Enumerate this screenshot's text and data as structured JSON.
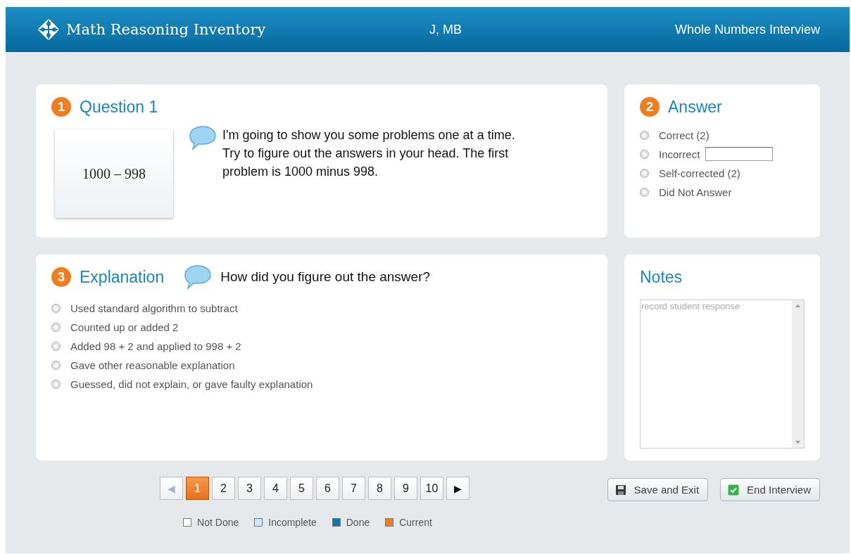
{
  "header": {
    "logo_text": "Math Reasoning Inventory",
    "student": "J, MB",
    "interview": "Whole Numbers Interview"
  },
  "question": {
    "number": "1",
    "title": "Question 1",
    "card_text": "1000 – 998",
    "prompt": "I'm going to show you some problems one at a time. Try to figure out the answers in your head. The first problem is 1000 minus 998."
  },
  "answer": {
    "number": "2",
    "title": "Answer",
    "options": [
      {
        "label": "Correct (2)",
        "selected": false,
        "kind": "radio"
      },
      {
        "label": "Incorrect",
        "selected": false,
        "kind": "with_field"
      },
      {
        "label": "Self-corrected (2)",
        "selected": false,
        "kind": "radio"
      },
      {
        "label": "Did Not Answer",
        "selected": false,
        "kind": "radio"
      }
    ]
  },
  "explanation": {
    "number": "3",
    "title": "Explanation",
    "prompt": "How did you figure out the answer?",
    "options": [
      {
        "label": "Used standard algorithm to subtract",
        "selected": false
      },
      {
        "label": "Counted up or added 2",
        "selected": false
      },
      {
        "label": "Added 98 + 2 and applied to 998 + 2",
        "selected": false
      },
      {
        "label": "Gave other reasonable explanation",
        "selected": false
      },
      {
        "label": "Guessed, did not explain, or gave faulty explanation",
        "selected": false
      }
    ]
  },
  "notes": {
    "title": "Notes",
    "placeholder": "record student response"
  },
  "pagination": {
    "prev": {
      "label": "◀",
      "disabled": true
    },
    "next": {
      "label": "▶",
      "disabled": false
    },
    "pages": [
      {
        "label": "1",
        "selected": true
      },
      {
        "label": "2",
        "selected": false
      },
      {
        "label": "3",
        "selected": false
      },
      {
        "label": "4",
        "selected": false
      },
      {
        "label": "5",
        "selected": false
      },
      {
        "label": "6",
        "selected": false
      },
      {
        "label": "7",
        "selected": false
      },
      {
        "label": "8",
        "selected": false
      },
      {
        "label": "9",
        "selected": false
      },
      {
        "label": "10",
        "selected": false
      }
    ]
  },
  "legend": [
    {
      "label": "Not Done",
      "color": "#ffffff"
    },
    {
      "label": "Incomplete",
      "color": "#cde8f6"
    },
    {
      "label": "Done",
      "color": "#1475a6"
    },
    {
      "label": "Current",
      "color": "#ef7d24"
    }
  ],
  "buttons": [
    {
      "label": "Save and Exit",
      "kind": "save"
    },
    {
      "label": "End Interview",
      "kind": "end"
    }
  ]
}
